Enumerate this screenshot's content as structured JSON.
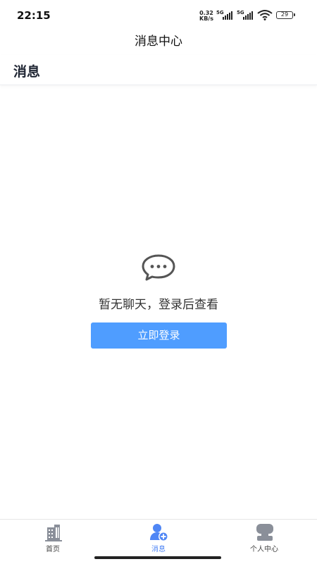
{
  "status_bar": {
    "time": "22:15",
    "net_speed_value": "0.32",
    "net_speed_unit": "KB/s",
    "signal1": "5G",
    "signal2": "5G",
    "battery": "29"
  },
  "app_title": "消息中心",
  "header": {
    "title": "消息"
  },
  "empty_state": {
    "icon": "chat-bubble-icon",
    "text": "暂无聊天，登录后查看",
    "login_button": "立即登录"
  },
  "tabbar": {
    "tabs": [
      {
        "label": "首页",
        "icon": "building-icon",
        "active": false
      },
      {
        "label": "消息",
        "icon": "user-add-icon",
        "active": true
      },
      {
        "label": "个人中心",
        "icon": "person-icon",
        "active": false
      }
    ]
  },
  "colors": {
    "accent": "#4f9dff",
    "tab_active": "#4f86f5",
    "tab_inactive": "#8a8f99"
  }
}
